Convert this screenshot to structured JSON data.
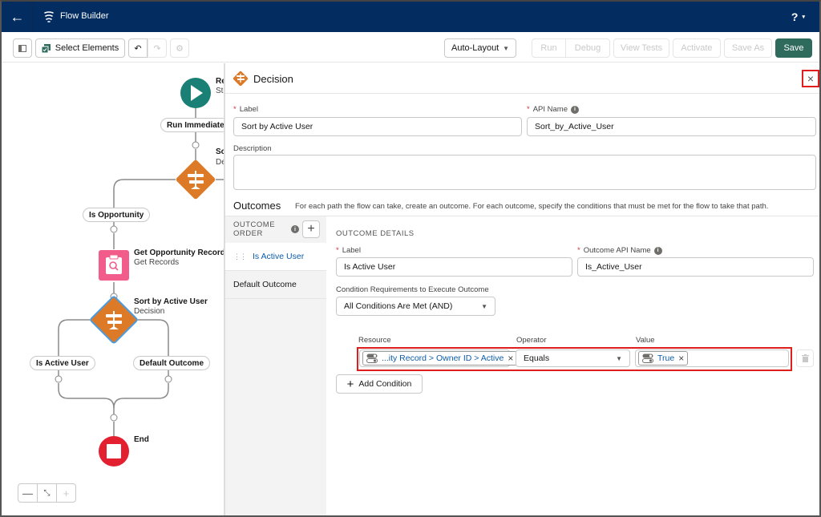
{
  "header": {
    "back_icon": "arrow-left-icon",
    "app_icon": "flow-icon",
    "title": "Flow Builder",
    "help_label": "?",
    "help_caret": "▾"
  },
  "toolbar": {
    "select_elements_label": "Select Elements",
    "layout_value": "Auto-Layout",
    "run_label": "Run",
    "debug_label": "Debug",
    "view_tests_label": "View Tests",
    "activate_label": "Activate",
    "save_as_label": "Save As",
    "save_label": "Save",
    "save_color": "#2e6b5c"
  },
  "canvas": {
    "start_title": "Re",
    "start_sub": "Sta",
    "run_immediately": "Run Immediately",
    "decision1_title": "So",
    "decision1_sub": "De",
    "branch_is_opportunity": "Is Opportunity",
    "get_records_title": "Get Opportunity Record",
    "get_records_sub": "Get Records",
    "decision2_title": "Sort by Active User",
    "decision2_sub": "Decision",
    "branch_is_active_user": "Is Active User",
    "branch_default_outcome": "Default Outcome",
    "end_title": "End",
    "zoom_out": "—",
    "zoom_fit": "⤡",
    "zoom_in": "+"
  },
  "panel": {
    "title": "Decision",
    "close": "×",
    "label_label": "Label",
    "label_value": "Sort by Active User",
    "api_name_label": "API Name",
    "api_name_value": "Sort_by_Active_User",
    "description_label": "Description",
    "description_value": "",
    "outcomes_title": "Outcomes",
    "outcomes_desc": "For each path the flow can take, create an outcome. For each outcome, specify the conditions that must be met for the flow to take that path.",
    "outcome_order_label": "OUTCOME ORDER",
    "outcome_order_line1": "OUTCOME",
    "outcome_order_line2": "ORDER",
    "outcome_items": [
      {
        "label": "Is Active User",
        "active": true
      },
      {
        "label": "Default Outcome",
        "active": false
      }
    ],
    "details": {
      "heading": "OUTCOME DETAILS",
      "label_label": "Label",
      "label_value": "Is Active User",
      "api_label": "Outcome API Name",
      "api_value": "Is_Active_User",
      "cond_req_label": "Condition Requirements to Execute Outcome",
      "cond_req_value": "All Conditions Are Met (AND)",
      "resource_label": "Resource",
      "operator_label": "Operator",
      "value_label": "Value",
      "resource_value": "...ity Record > Owner ID > Active",
      "operator_value": "Equals",
      "value_value": "True",
      "add_condition": "Add Condition"
    }
  },
  "colors": {
    "header_bg": "#032d60",
    "start_node": "#1a7f74",
    "decision_node": "#dd7a27",
    "get_records_node": "#f25c8a",
    "end_node": "#e3202f",
    "highlight": "#e01e1e",
    "link_blue": "#0b5cab"
  }
}
